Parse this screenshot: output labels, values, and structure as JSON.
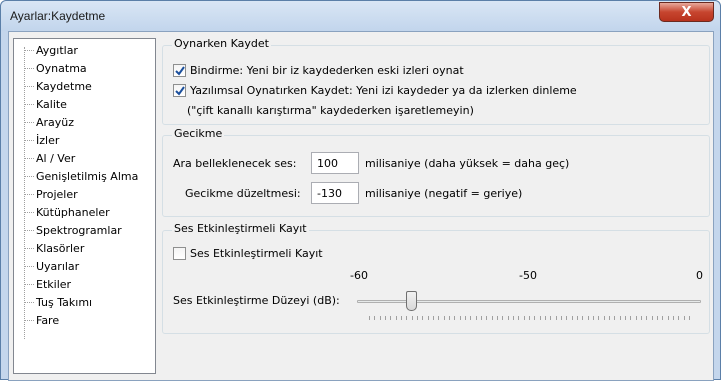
{
  "window": {
    "title": "Ayarlar:Kaydetme",
    "close_glyph": "X"
  },
  "sidebar": {
    "items": [
      {
        "label": "Aygıtlar"
      },
      {
        "label": "Oynatma"
      },
      {
        "label": "Kaydetme",
        "selected": true
      },
      {
        "label": "Kalite"
      },
      {
        "label": "Arayüz"
      },
      {
        "label": "İzler"
      },
      {
        "label": "Al / Ver"
      },
      {
        "label": "Genişletilmiş Alma"
      },
      {
        "label": "Projeler"
      },
      {
        "label": "Kütüphaneler"
      },
      {
        "label": "Spektrogramlar"
      },
      {
        "label": "Klasörler"
      },
      {
        "label": "Uyarılar"
      },
      {
        "label": "Etkiler"
      },
      {
        "label": "Tuş Takımı"
      },
      {
        "label": "Fare"
      }
    ]
  },
  "playthrough": {
    "title": "Oynarken Kaydet",
    "overdub_label": "Bindirme: Yeni bir iz kaydederken eski izleri oynat",
    "overdub_checked": true,
    "software_label_line1": "Yazılımsal Oynatırken Kaydet: Yeni izi kaydeder ya da izlerken dinleme",
    "software_label_line2": "(\"çift kanallı karıştırma\" kaydederken işaretlemeyin)",
    "software_checked": true
  },
  "latency": {
    "title": "Gecikme",
    "buffer_label": "Ara belleklenecek ses:",
    "buffer_value": "100",
    "buffer_unit": "milisaniye (daha yüksek = daha geç)",
    "correction_label": "Gecikme düzeltmesi:",
    "correction_value": "-130",
    "correction_unit": "milisaniye (negatif = geriye)"
  },
  "sound_activated": {
    "title": "Ses Etkinleştirmeli Kayıt",
    "checkbox_label": "Ses Etkinleştirmeli Kayıt",
    "checked": false,
    "scale_min": "-60",
    "scale_mid": "-50",
    "scale_max": "0",
    "level_label": "Ses Etkinleştirme Düzeyi (dB):",
    "level_value": -50
  }
}
